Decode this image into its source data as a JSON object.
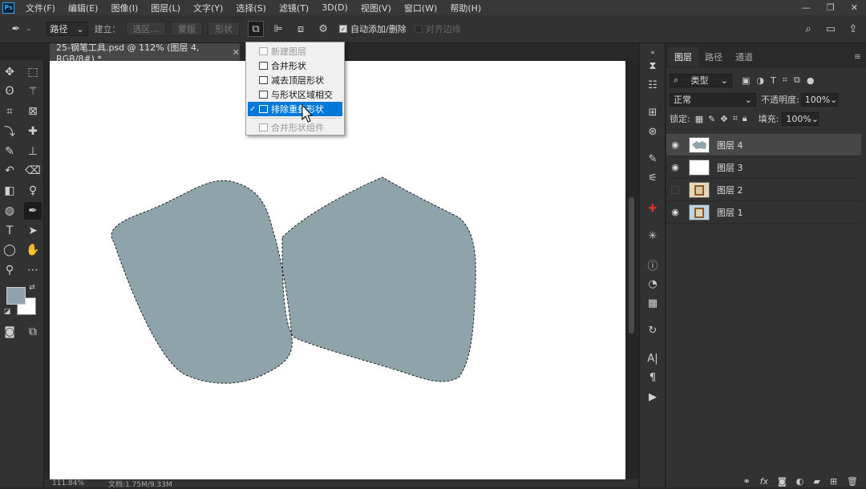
{
  "app": {
    "logo": "Ps"
  },
  "menu": [
    "文件(F)",
    "编辑(E)",
    "图像(I)",
    "图层(L)",
    "文字(Y)",
    "选择(S)",
    "滤镜(T)",
    "3D(D)",
    "视图(V)",
    "窗口(W)",
    "帮助(H)"
  ],
  "options": {
    "mode_value": "路径",
    "make_label": "建立：",
    "selection_btn": "选区...",
    "mask_btn": "蒙版",
    "shape_btn": "形状",
    "auto_add_delete": "自动添加/删除",
    "align_edges": "对齐边缘"
  },
  "document": {
    "tab_title": "25-钢笔工具.psd @ 112% (图层 4, RGB/8#) *",
    "zoom": "111.84%",
    "doc_info": "文档:1.75M/9.33M"
  },
  "path_ops_menu": {
    "items": [
      {
        "label": "新建图层",
        "disabled": true,
        "checked": false
      },
      {
        "label": "合并形状",
        "disabled": false,
        "checked": false
      },
      {
        "label": "减去顶层形状",
        "disabled": false,
        "checked": false
      },
      {
        "label": "与形状区域相交",
        "disabled": false,
        "checked": false
      },
      {
        "label": "排除重叠形状",
        "disabled": false,
        "checked": true,
        "highlighted": true
      },
      {
        "label": "合并形状组件",
        "disabled": true,
        "checked": false
      }
    ]
  },
  "layers_panel": {
    "tabs": [
      "图层",
      "路径",
      "通道"
    ],
    "filter_kind": "类型",
    "blend_mode": "正常",
    "opacity_label": "不透明度:",
    "opacity_value": "100%",
    "lock_label": "锁定:",
    "fill_label": "填充:",
    "fill_value": "100%",
    "layers": [
      {
        "name": "图层 4",
        "visible": true,
        "selected": true
      },
      {
        "name": "图层 3",
        "visible": true,
        "selected": false
      },
      {
        "name": "图层 2",
        "visible": false,
        "selected": false
      },
      {
        "name": "图层 1",
        "visible": true,
        "selected": false
      }
    ]
  },
  "colors": {
    "shape_fill": "#8fa3ab",
    "highlight": "#0078d7",
    "foreground": "#8fa3ab",
    "background": "#ffffff"
  }
}
